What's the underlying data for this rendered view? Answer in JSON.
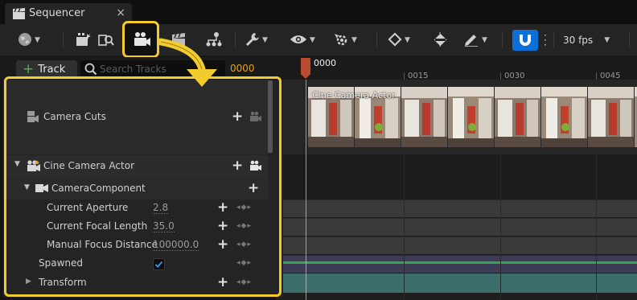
{
  "tab": {
    "title": "Sequencer",
    "close": "×"
  },
  "toolbar": {
    "fps_label": "30 fps",
    "icons": [
      "world-icon",
      "render-movie-icon",
      "find-icon",
      "camera-add-icon",
      "clapper-icon",
      "tree-icon",
      "wrench-icon",
      "eye-icon",
      "snap-settings-icon",
      "key-icon",
      "key-interp-icon",
      "pencil-icon",
      "magnet-icon"
    ]
  },
  "left": {
    "add_track_label": "Track",
    "search_placeholder": "Search Tracks",
    "frame_counter": "0000"
  },
  "timeline": {
    "playhead_label": "0000",
    "ruler_labels": [
      "0015",
      "0030",
      "0045"
    ],
    "thumbnail_label": "Cine Camera Actor"
  },
  "tracks": {
    "camera_cuts": "Camera Cuts",
    "cine_camera_actor": "Cine Camera Actor",
    "camera_component": "CameraComponent",
    "properties": [
      {
        "label": "Current Aperture",
        "value": "2.8"
      },
      {
        "label": "Current Focal Length",
        "value": "35.0"
      },
      {
        "label": "Manual Focus Distance",
        "value": "100000.0"
      }
    ],
    "spawned": "Spawned",
    "spawned_checked": true,
    "transform": "Transform"
  },
  "colors": {
    "highlight": "#f2cc2c",
    "accent_blue": "#0a70d8",
    "frame_orange": "#e8a218",
    "add_green": "#3fbf3f"
  }
}
